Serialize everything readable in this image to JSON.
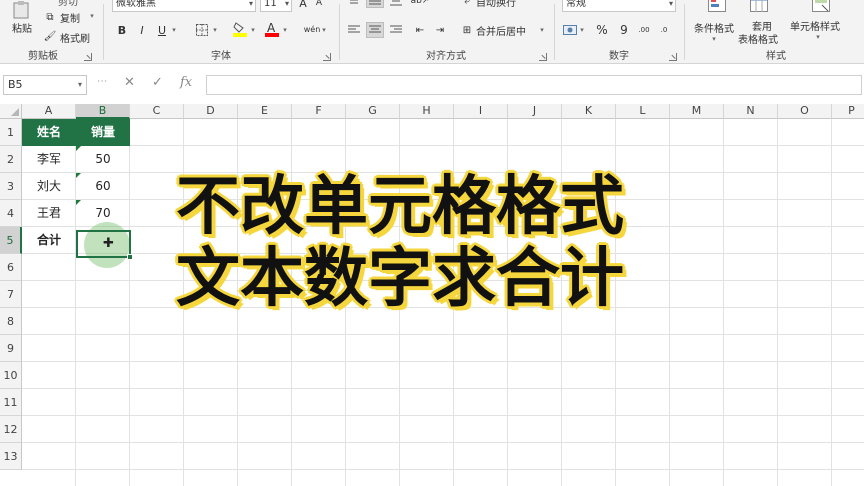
{
  "ribbon": {
    "clipboard": {
      "label": "剪贴板",
      "paste": "粘贴",
      "cut": "剪切",
      "copy": "复制",
      "format_painter": "格式刷"
    },
    "font": {
      "label": "字体",
      "font_name": "微软雅黑",
      "font_size": "11",
      "bold": "B",
      "italic": "I",
      "underline": "U",
      "font_color": "#ff0000",
      "fill_color": "#ffff00"
    },
    "alignment": {
      "label": "对齐方式",
      "wrap_text": "自动换行",
      "merge_center": "合并后居中"
    },
    "number": {
      "label": "数字",
      "format": "常规",
      "percent": "%",
      "comma": "9"
    },
    "styles": {
      "label": "样式",
      "conditional_format": "条件格式",
      "table_format_1": "套用",
      "table_format_2": "表格格式",
      "cell_styles": "单元格样式"
    }
  },
  "formula_bar": {
    "name_box": "B5",
    "cancel": "✕",
    "enter": "✓",
    "fx": "fx",
    "value": ""
  },
  "columns": [
    "A",
    "B",
    "C",
    "D",
    "E",
    "F",
    "G",
    "H",
    "I",
    "J",
    "K",
    "L",
    "M",
    "N",
    "O",
    "P"
  ],
  "rows": [
    "1",
    "2",
    "3",
    "4",
    "5",
    "6",
    "7",
    "8",
    "9",
    "10",
    "11",
    "12",
    "13"
  ],
  "sheet": {
    "header": {
      "name": "姓名",
      "sales": "销量"
    },
    "data": [
      {
        "name": "李军",
        "sales": "50"
      },
      {
        "name": "刘大",
        "sales": "60"
      },
      {
        "name": "王君",
        "sales": "70"
      }
    ],
    "total_label": "合计"
  },
  "overlay": {
    "line1": "不改单元格格式",
    "line2": "文本数字求合计"
  },
  "colors": {
    "excel_green": "#217346",
    "caption_outline": "#f5d63c"
  }
}
